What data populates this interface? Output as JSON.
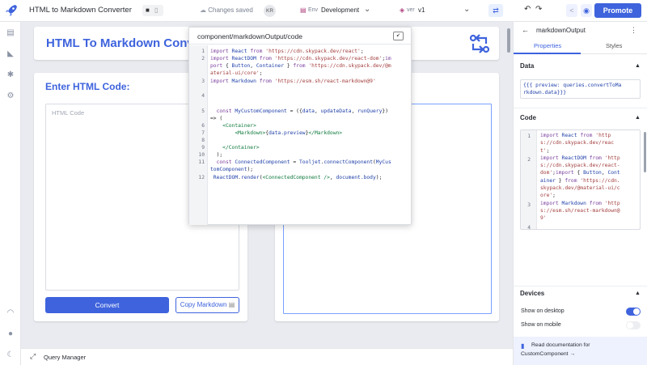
{
  "header": {
    "app_title": "HTML to Markdown Converter",
    "saved_status": "Changes saved",
    "avatar_initials": "KR",
    "env_label": "Env",
    "env_value": "Development",
    "version_label": "ver",
    "version_value": "v1",
    "promote_label": "Promote",
    "accent_color": "#3e63dd"
  },
  "canvas": {
    "title": "HTML To Markdown Converte",
    "input_heading": "Enter HTML Code:",
    "input_placeholder": "HTML Code",
    "convert_label": "Convert",
    "copy_label": "Copy Markdown"
  },
  "query_bar": {
    "label": "Query Manager"
  },
  "popup": {
    "title": "component/markdownOutput/code",
    "line_numbers": [
      "1",
      "2",
      "3",
      "4",
      "5",
      "6",
      "7",
      "8",
      "9",
      "10",
      "11",
      "12"
    ]
  },
  "inspector": {
    "component_name": "markdownOutput",
    "tab_properties": "Properties",
    "tab_styles": "Styles",
    "data_heading": "Data",
    "data_value_line1": "{{{ preview: queries.convertToMa",
    "data_value_line2": "rkdown.data}}}",
    "code_heading": "Code",
    "code_line_numbers": [
      "1",
      "2",
      "3",
      "4"
    ],
    "devices_heading": "Devices",
    "show_desktop": "Show on desktop",
    "show_mobile": "Show on mobile",
    "doc_link_line1": "Read documentation for",
    "doc_link_line2": "CustomComponent →"
  }
}
